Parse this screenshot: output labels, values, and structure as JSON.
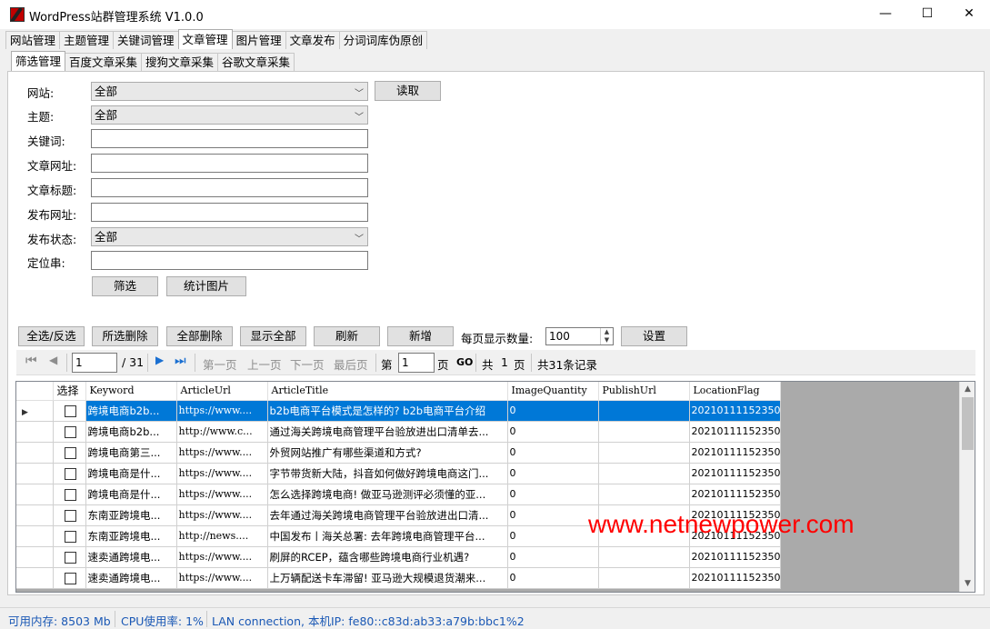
{
  "window": {
    "title": "WordPress站群管理系统 V1.0.0",
    "minimize": "—",
    "maximize": "☐",
    "close": "✕"
  },
  "main_tabs": [
    "网站管理",
    "主题管理",
    "关键词管理",
    "文章管理",
    "图片管理",
    "文章发布",
    "分词词库伪原创"
  ],
  "main_active_tab": "文章管理",
  "sub_tabs": [
    "筛选管理",
    "百度文章采集",
    "搜狗文章采集",
    "谷歌文章采集"
  ],
  "sub_active_tab": "筛选管理",
  "filter": {
    "site_label": "网站:",
    "site_value": "全部",
    "read_button": "读取",
    "theme_label": "主题:",
    "theme_value": "全部",
    "keyword_label": "关键词:",
    "article_url_label": "文章网址:",
    "article_title_label": "文章标题:",
    "publish_url_label": "发布网址:",
    "publish_status_label": "发布状态:",
    "publish_status_value": "全部",
    "location_label": "定位串:",
    "filter_button": "筛选",
    "count_images_button": "统计图片"
  },
  "actions": {
    "select_all": "全选/反选",
    "delete_selected": "所选删除",
    "delete_all": "全部删除",
    "show_all": "显示全部",
    "refresh": "刷新",
    "add": "新增",
    "per_page_label": "每页显示数量:",
    "per_page_value": "100",
    "settings": "设置"
  },
  "navigator": {
    "current_page": "1",
    "total_pages": "/ 31",
    "first_page": "第一页",
    "prev_page": "上一页",
    "next_page": "下一页",
    "last_page": "最后页",
    "goto_prefix": "第",
    "goto_value": "1",
    "goto_suffix": "页",
    "go": "GO",
    "total_prefix": "共",
    "total_pages_num": "1",
    "total_suffix": "页",
    "records": "共31条记录"
  },
  "grid": {
    "columns": [
      "选择",
      "Keyword",
      "ArticleUrl",
      "ArticleTitle",
      "ImageQuantity",
      "PublishUrl",
      "LocationFlag"
    ],
    "rows": [
      {
        "keyword": "跨境电商b2b...",
        "url": "https://www....",
        "title": "b2b电商平台模式是怎样的? b2b电商平台介绍",
        "images": "0",
        "publish": "",
        "flag": "20210111152350"
      },
      {
        "keyword": "跨境电商b2b...",
        "url": "http://www.c...",
        "title": "通过海关跨境电商管理平台验放进出口清单去...",
        "images": "0",
        "publish": "",
        "flag": "20210111152350"
      },
      {
        "keyword": "跨境电商第三...",
        "url": "https://www....",
        "title": "外贸网站推广有哪些渠道和方式?",
        "images": "0",
        "publish": "",
        "flag": "20210111152350"
      },
      {
        "keyword": "跨境电商是什...",
        "url": "https://www....",
        "title": "字节带货新大陆，抖音如何做好跨境电商这门...",
        "images": "0",
        "publish": "",
        "flag": "20210111152350"
      },
      {
        "keyword": "跨境电商是什...",
        "url": "https://www....",
        "title": "怎么选择跨境电商! 做亚马逊测评必须懂的亚...",
        "images": "0",
        "publish": "",
        "flag": "20210111152350"
      },
      {
        "keyword": "东南亚跨境电...",
        "url": "https://www....",
        "title": "去年通过海关跨境电商管理平台验放进出口清...",
        "images": "0",
        "publish": "",
        "flag": "20210111152350"
      },
      {
        "keyword": "东南亚跨境电...",
        "url": "http://news....",
        "title": "中国发布丨海关总署: 去年跨境电商管理平台...",
        "images": "0",
        "publish": "",
        "flag": "20210111152350"
      },
      {
        "keyword": "速卖通跨境电...",
        "url": "https://www....",
        "title": "刷屏的RCEP，蕴含哪些跨境电商行业机遇?",
        "images": "0",
        "publish": "",
        "flag": "20210111152350"
      },
      {
        "keyword": "速卖通跨境电...",
        "url": "https://www....",
        "title": "上万辆配送卡车滞留! 亚马逊大规模退货潮来...",
        "images": "0",
        "publish": "",
        "flag": "20210111152350"
      }
    ]
  },
  "watermark": "www.netnewpower.com",
  "status": {
    "memory": "可用内存: 8503 Mb",
    "cpu": "CPU使用率: 1%",
    "network": "LAN connection,  本机IP: fe80::c83d:ab33:a79b:bbc1%2"
  }
}
